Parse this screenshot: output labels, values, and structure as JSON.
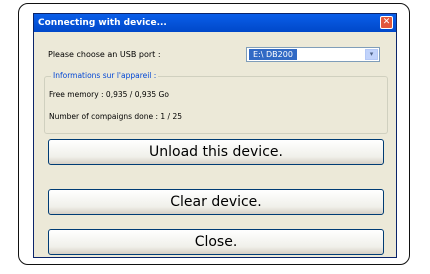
{
  "window": {
    "title": "Connecting with device...",
    "close_glyph": "✕"
  },
  "port": {
    "label": "Please choose an USB port :",
    "selected": "E:\\ DB200",
    "arrow_glyph": "▾"
  },
  "info": {
    "legend": "Informations sur l'appareil :",
    "free_memory": "Free memory : 0,935 / 0,935 Go",
    "compaigns": "Number of compaigns done : 1 / 25"
  },
  "buttons": {
    "unload": "Unload this device.",
    "clear": "Clear device.",
    "close": "Close."
  },
  "colors": {
    "titlebar": "#0054e3",
    "legend_text": "#0046d5",
    "selection": "#316ac5"
  }
}
